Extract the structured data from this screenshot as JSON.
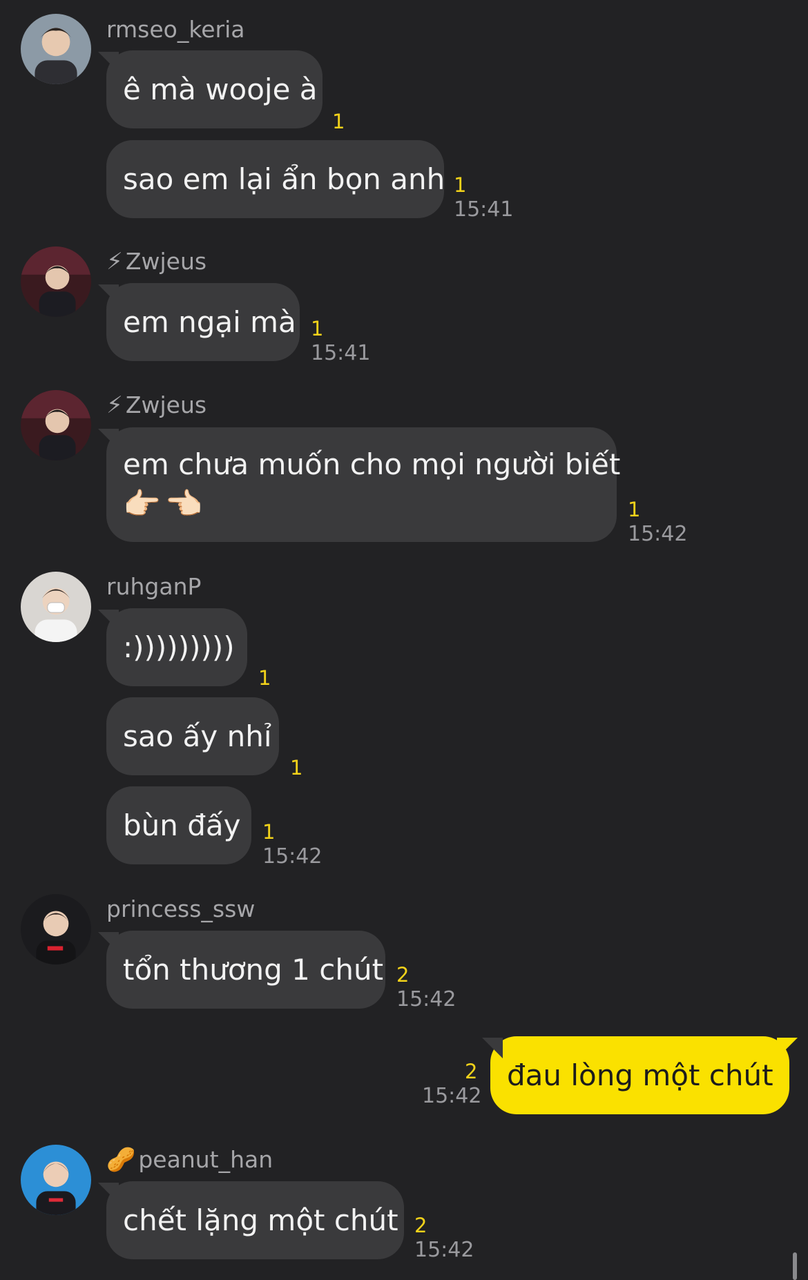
{
  "messages": {
    "g1": {
      "sender": "rmseo_keria",
      "b1": "ê mà wooje à",
      "b1_unread": "1",
      "b2": "sao em lại ẩn bọn anh",
      "b2_unread": "1",
      "time": "15:41"
    },
    "g2": {
      "sender_emoji": "⚡",
      "sender": "Zwjeus",
      "b1": "em ngại mà",
      "b1_unread": "1",
      "time": "15:41"
    },
    "g3": {
      "sender_emoji": "⚡",
      "sender": "Zwjeus",
      "b1_line1": "em chưa muốn cho mọi người biết",
      "b1_line2": "👉🏻👈🏻",
      "b1_unread": "1",
      "time": "15:42"
    },
    "g4": {
      "sender": "ruhganP",
      "b1": ":)))))))))",
      "b1_unread": "1",
      "b2": "sao ấy nhỉ",
      "b2_unread": "1",
      "b3": "bùn đấy",
      "b3_unread": "1",
      "time": "15:42"
    },
    "g5": {
      "sender": "princess_ssw",
      "b1": "tổn thương 1 chút",
      "b1_unread": "2",
      "time": "15:42"
    },
    "mine": {
      "b1": "đau lòng một chút",
      "b1_unread": "2",
      "time": "15:42"
    },
    "g6": {
      "sender_emoji": "🥜",
      "sender": "peanut_han",
      "b1": "chết lặng một chút",
      "b1_unread": "2",
      "time": "15:42"
    }
  },
  "colors": {
    "background": "#222224",
    "bubble_other": "#3a3a3c",
    "bubble_mine": "#fae100",
    "unread": "#f2d21a"
  }
}
